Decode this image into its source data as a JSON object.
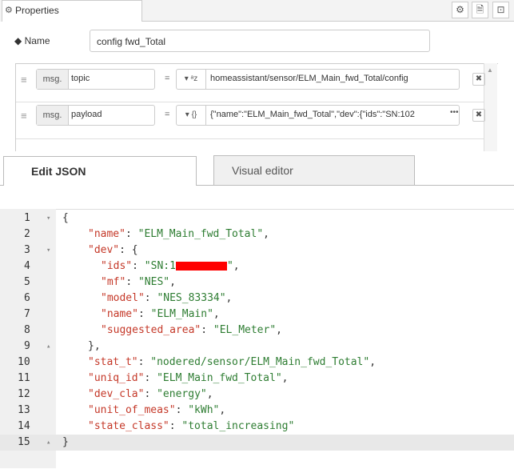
{
  "tab": {
    "label": "Properties"
  },
  "toolbar": {
    "gear": "⚙",
    "doc": "🗎",
    "layout": "⊡"
  },
  "name_field": {
    "label": "Name",
    "value": "config fwd_Total"
  },
  "rules": [
    {
      "prefix": "msg.",
      "property": "topic",
      "eq": "=",
      "type": "ᵃz",
      "value": "homeassistant/sensor/ELM_Main_fwd_Total/config"
    },
    {
      "prefix": "msg.",
      "property": "payload",
      "eq": "=",
      "type": "{}",
      "value": "{\"name\":\"ELM_Main_fwd_Total\",\"dev\":{\"ids\":\"SN:102",
      "more": "•••"
    }
  ],
  "editor_tabs": {
    "edit_json": "Edit JSON",
    "visual": "Visual editor"
  },
  "code_lines": [
    {
      "n": "1",
      "fold": "▾"
    },
    {
      "n": "2",
      "key": "\"name\"",
      "val": "\"ELM_Main_fwd_Total\""
    },
    {
      "n": "3",
      "fold": "▾",
      "key": "\"dev\""
    },
    {
      "n": "4",
      "key": "\"ids\"",
      "val": "\"SN:1"
    },
    {
      "n": "5",
      "key": "\"mf\"",
      "val": "\"NES\""
    },
    {
      "n": "6",
      "key": "\"model\"",
      "val": "\"NES_83334\""
    },
    {
      "n": "7",
      "key": "\"name\"",
      "val": "\"ELM_Main\""
    },
    {
      "n": "8",
      "key": "\"suggested_area\"",
      "val": "\"EL_Meter\""
    },
    {
      "n": "9",
      "fold": "▴"
    },
    {
      "n": "10",
      "key": "\"stat_t\"",
      "val": "\"nodered/sensor/ELM_Main_fwd_Total\""
    },
    {
      "n": "11",
      "key": "\"uniq_id\"",
      "val": "\"ELM_Main_fwd_Total\""
    },
    {
      "n": "12",
      "key": "\"dev_cla\"",
      "val": "\"energy\""
    },
    {
      "n": "13",
      "key": "\"unit_of_meas\"",
      "val": "\"kWh\""
    },
    {
      "n": "14",
      "key": "\"state_class\"",
      "val": "\"total_increasing\""
    },
    {
      "n": "15",
      "fold": "▴"
    }
  ]
}
